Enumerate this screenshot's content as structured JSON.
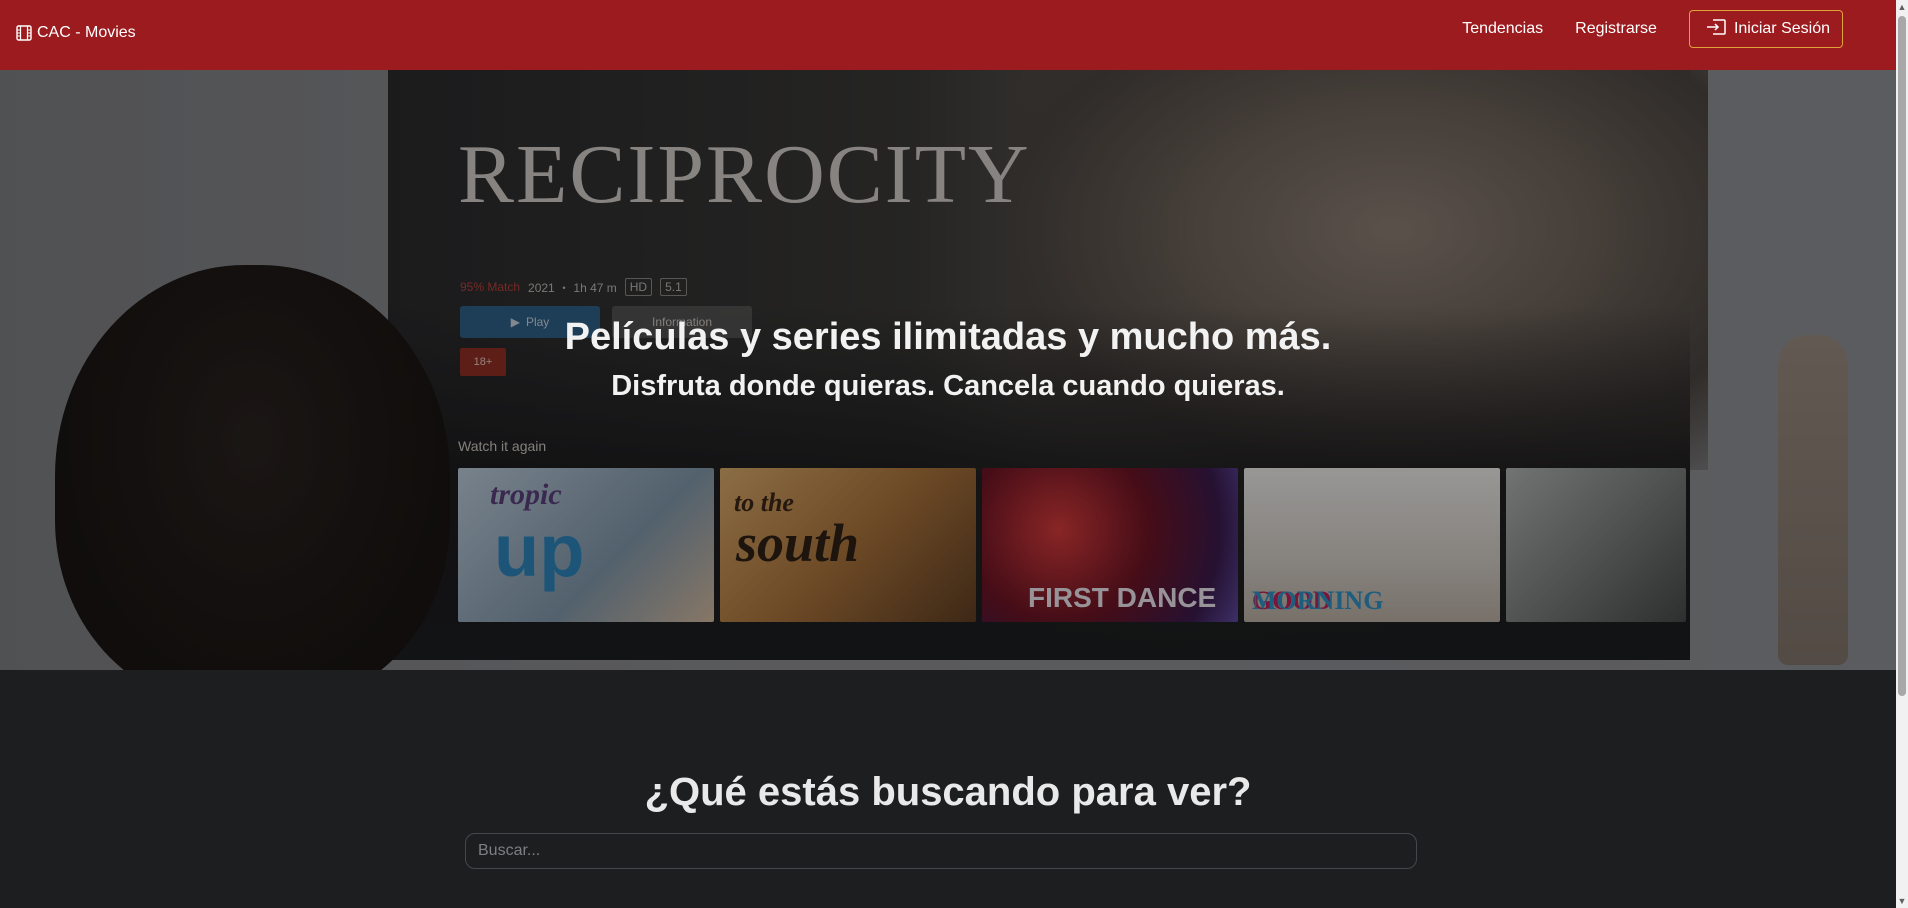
{
  "navbar": {
    "brand": "CAC - Movies",
    "brand_icon": "film-icon",
    "links": [
      "Tendencias",
      "Registrarse"
    ],
    "login_label": "Iniciar Sesión",
    "login_icon": "sign-in-icon",
    "background": "#9b1b1f",
    "login_border": "#e0a23a"
  },
  "hero": {
    "title": "Películas y series ilimitadas y mucho más.",
    "subtitle": "Disfruta donde quieras. Cancela cuando quieras.",
    "background_image": {
      "show_title": "RECIPROCITY",
      "match": "95% Match",
      "meta": "2021 ・ 1h 47 m",
      "chips": [
        "HD",
        "5.1"
      ],
      "play_label": "Play",
      "info_label": "Information",
      "age_rating": "18+",
      "row_label": "Watch it again",
      "thumbnails": [
        {
          "line1": "tropic",
          "line2": "up"
        },
        {
          "line1": "to the",
          "line2": "south"
        },
        {
          "line1": "FIRST DANCE",
          "line2": ""
        },
        {
          "line1": "GOOD",
          "line2": "MORNING"
        },
        {
          "line1": "",
          "line2": ""
        }
      ]
    }
  },
  "search": {
    "title": "¿Qué estás buscando para ver?",
    "placeholder": "Buscar...",
    "value": ""
  }
}
